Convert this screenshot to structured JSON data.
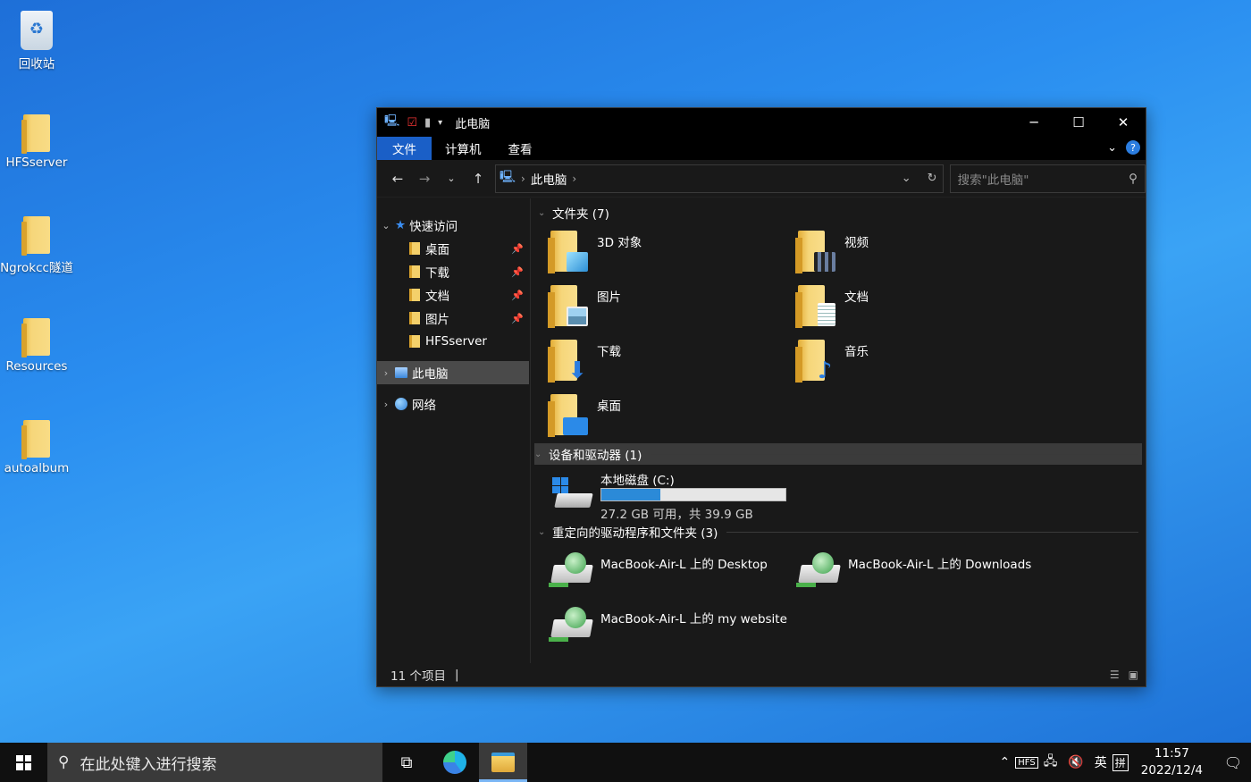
{
  "desktop": {
    "icons": [
      {
        "label": "回收站",
        "icon": "recycle-bin-icon"
      },
      {
        "label": "HFSserver",
        "icon": "folder-icon"
      },
      {
        "label": "Ngrokcc隧道",
        "icon": "folder-icon"
      },
      {
        "label": "Resources",
        "icon": "folder-icon"
      },
      {
        "label": "autoalbum",
        "icon": "folder-icon"
      }
    ]
  },
  "window": {
    "title": "此电脑",
    "ribbon_tabs": [
      "文件",
      "计算机",
      "查看"
    ],
    "address": {
      "crumb": "此电脑",
      "search_placeholder": "搜索\"此电脑\""
    },
    "nav_pane": {
      "quick_access": "快速访问",
      "quick_items": [
        "桌面",
        "下载",
        "文档",
        "图片",
        "HFSserver"
      ],
      "this_pc": "此电脑",
      "network": "网络"
    },
    "groups": {
      "folders": "文件夹 (7)",
      "devices": "设备和驱动器 (1)",
      "redirected": "重定向的驱动程序和文件夹 (3)"
    },
    "folders": [
      "3D 对象",
      "视频",
      "图片",
      "文档",
      "下载",
      "音乐",
      "桌面"
    ],
    "drive": {
      "name": "本地磁盘 (C:)",
      "size_text": "27.2 GB 可用，共 39.9 GB",
      "used_fraction": 0.318
    },
    "redirected": [
      "MacBook-Air-L 上的 Desktop",
      "MacBook-Air-L 上的 Downloads",
      "MacBook-Air-L 上的 my website"
    ],
    "status": "11 个项目"
  },
  "taskbar": {
    "search_placeholder": "在此处键入进行搜索",
    "ime": "英",
    "ime2": "拼",
    "time": "11:57",
    "date": "2022/12/4"
  },
  "colors": {
    "accent": "#1a5fc7",
    "drive_fill": "#2b8ad8"
  }
}
